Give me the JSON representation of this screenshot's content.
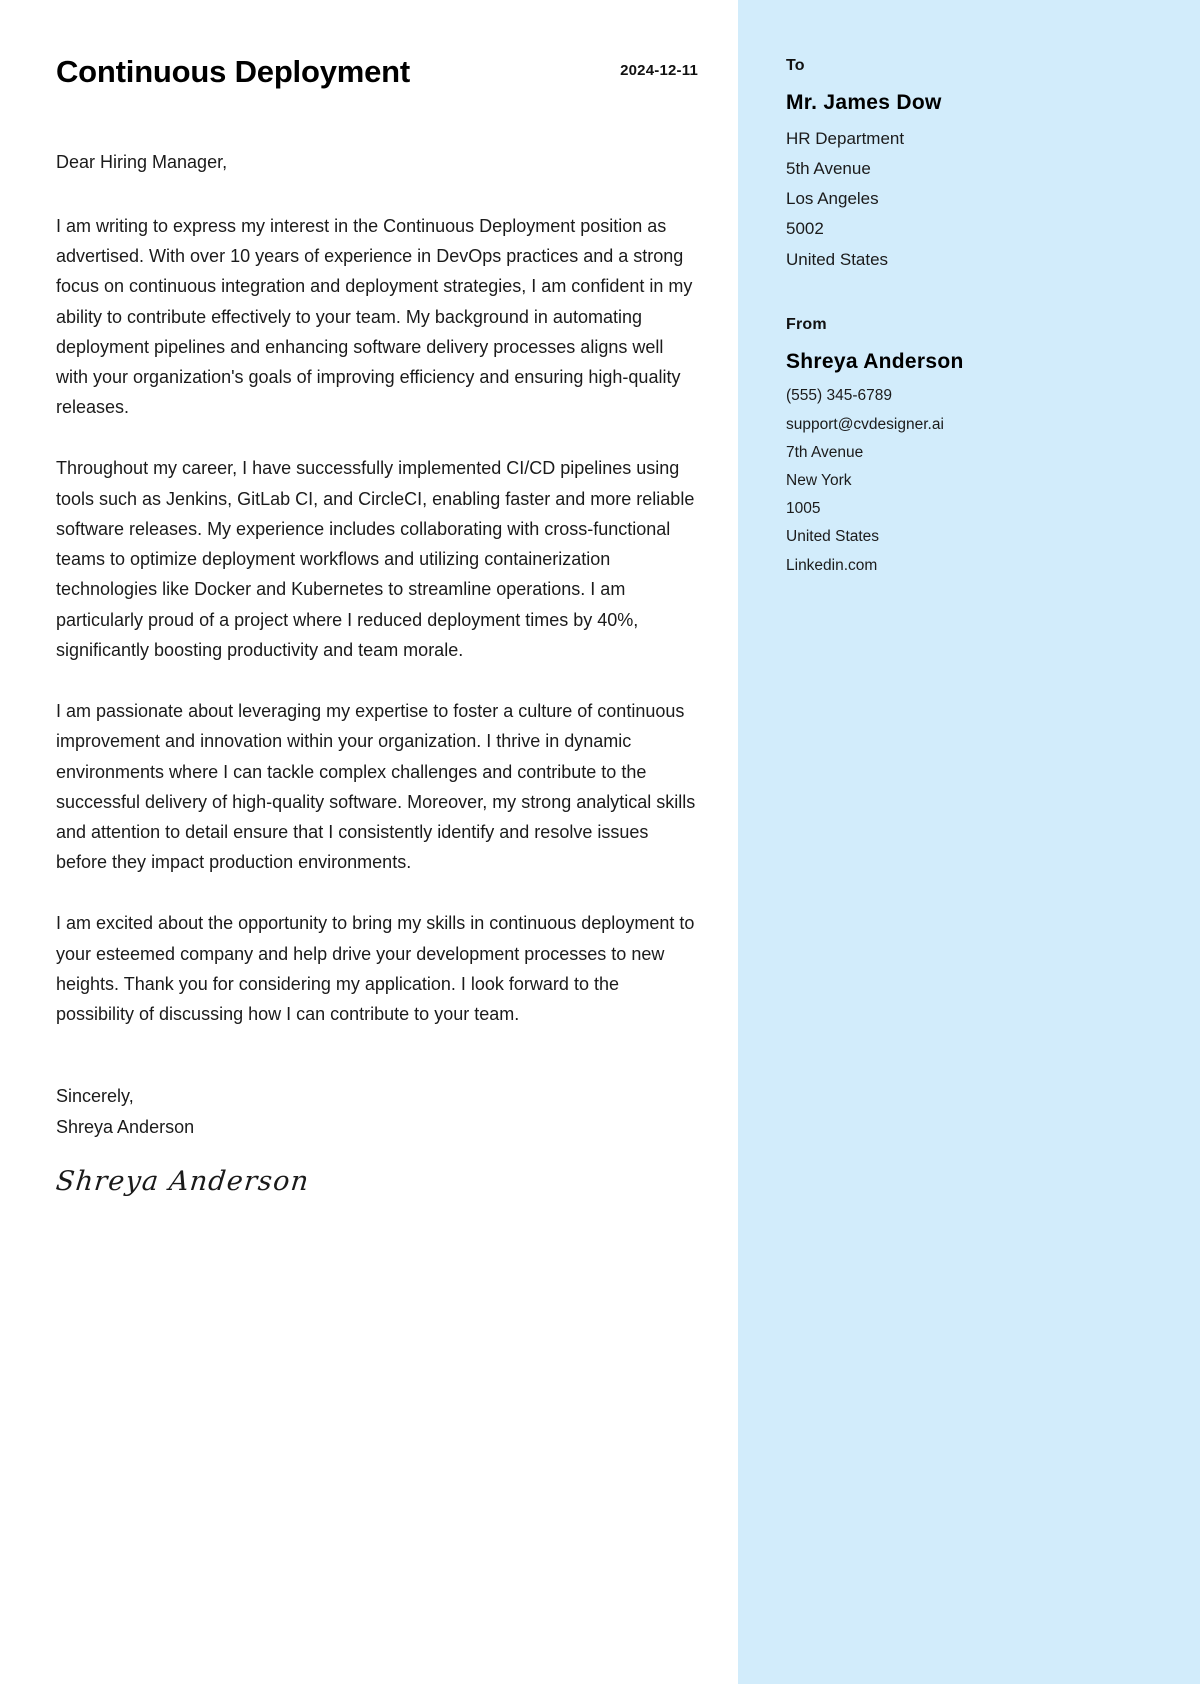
{
  "document": {
    "type": "cover-letter",
    "accent_color": "#d2ecfb",
    "text_color": "#1b1b1b"
  },
  "letter": {
    "title": "Continuous Deployment",
    "date": "2024-12-11",
    "salutation": "Dear Hiring Manager,",
    "paragraphs": [
      "I am writing to express my interest in the Continuous Deployment position as advertised. With over 10 years of experience in DevOps practices and a strong focus on continuous integration and deployment strategies, I am confident in my ability to contribute effectively to your team. My background in automating deployment pipelines and enhancing software delivery processes aligns well with your organization's goals of improving efficiency and ensuring high-quality releases.",
      "Throughout my career, I have successfully implemented CI/CD pipelines using tools such as Jenkins, GitLab CI, and CircleCI, enabling faster and more reliable software releases. My experience includes collaborating with cross-functional teams to optimize deployment workflows and utilizing containerization technologies like Docker and Kubernetes to streamline operations. I am particularly proud of a project where I reduced deployment times by 40%, significantly boosting productivity and team morale.",
      "I am passionate about leveraging my expertise to foster a culture of continuous improvement and innovation within your organization. I thrive in dynamic environments where I can tackle complex challenges and contribute to the successful delivery of high-quality software. Moreover, my strong analytical skills and attention to detail ensure that I consistently identify and resolve issues before they impact production environments.",
      "I am excited about the opportunity to bring my skills in continuous deployment to your esteemed company and help drive your development processes to new heights. Thank you for considering my application. I look forward to the possibility of discussing how I can contribute to your team."
    ],
    "closing_word": "Sincerely,",
    "closing_name": "Shreya Anderson",
    "signature": "Shreya Anderson"
  },
  "sidebar": {
    "to": {
      "label": "To",
      "name": "Mr. James Dow",
      "lines": [
        "HR Department",
        "5th Avenue",
        "Los Angeles",
        "5002",
        "United States"
      ]
    },
    "from": {
      "label": "From",
      "name": "Shreya Anderson",
      "lines": [
        "(555) 345-6789",
        "support@cvdesigner.ai",
        "7th Avenue",
        "New York",
        "1005",
        "United States",
        "Linkedin.com"
      ]
    }
  }
}
